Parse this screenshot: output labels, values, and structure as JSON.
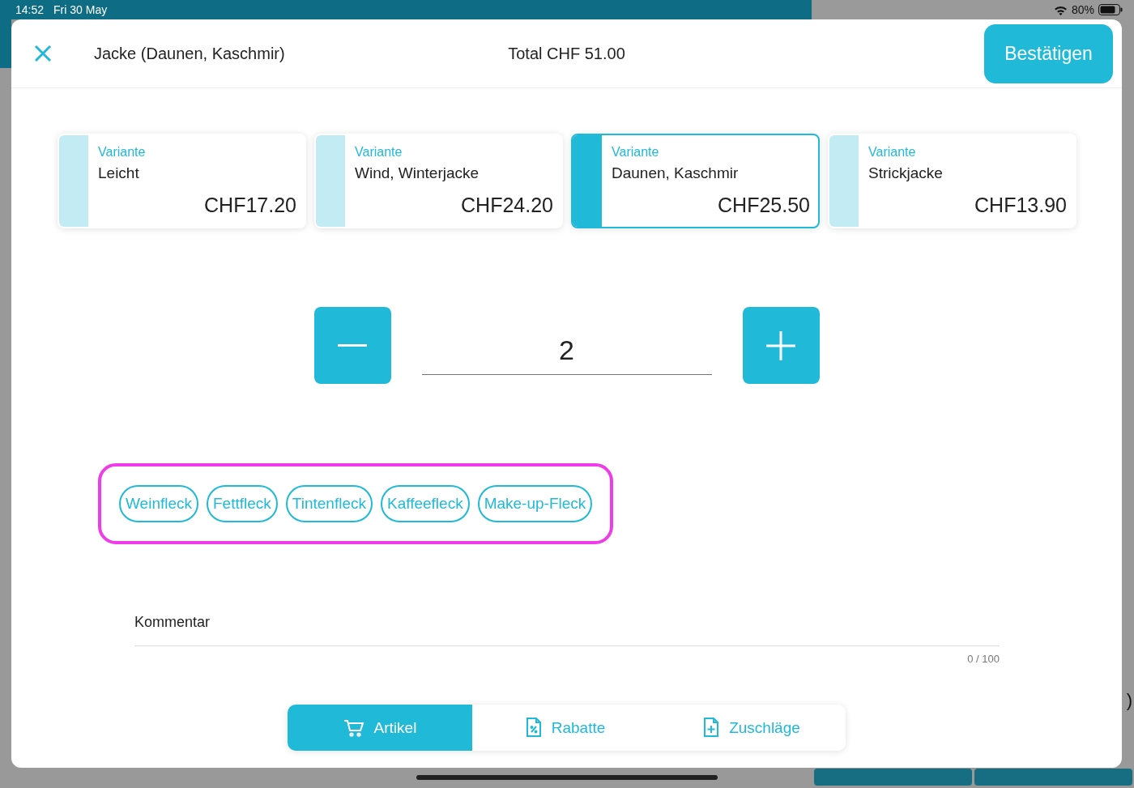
{
  "status_bar": {
    "time": "14:52",
    "date": "Fri 30 May",
    "battery": "80%"
  },
  "header": {
    "title": "Jacke (Daunen, Kaschmir)",
    "total": "Total CHF 51.00",
    "confirm_button": "Bestätigen"
  },
  "variants": [
    {
      "label": "Variante",
      "name": "Leicht",
      "price": "CHF17.20",
      "selected": false
    },
    {
      "label": "Variante",
      "name": "Wind, Winterjacke",
      "price": "CHF24.20",
      "selected": false
    },
    {
      "label": "Variante",
      "name": "Daunen, Kaschmir",
      "price": "CHF25.50",
      "selected": true
    },
    {
      "label": "Variante",
      "name": "Strickjacke",
      "price": "CHF13.90",
      "selected": false
    }
  ],
  "quantity": {
    "value": "2"
  },
  "stain_tags": [
    "Weinfleck",
    "Fettfleck",
    "Tintenfleck",
    "Kaffeefleck",
    "Make-up-Fleck"
  ],
  "comment": {
    "label": "Kommentar",
    "counter": "0 / 100"
  },
  "tabs": [
    {
      "label": "Artikel",
      "selected": true
    },
    {
      "label": "Rabatte",
      "selected": false
    },
    {
      "label": "Zuschläge",
      "selected": false
    }
  ],
  "background_fragment": ")"
}
